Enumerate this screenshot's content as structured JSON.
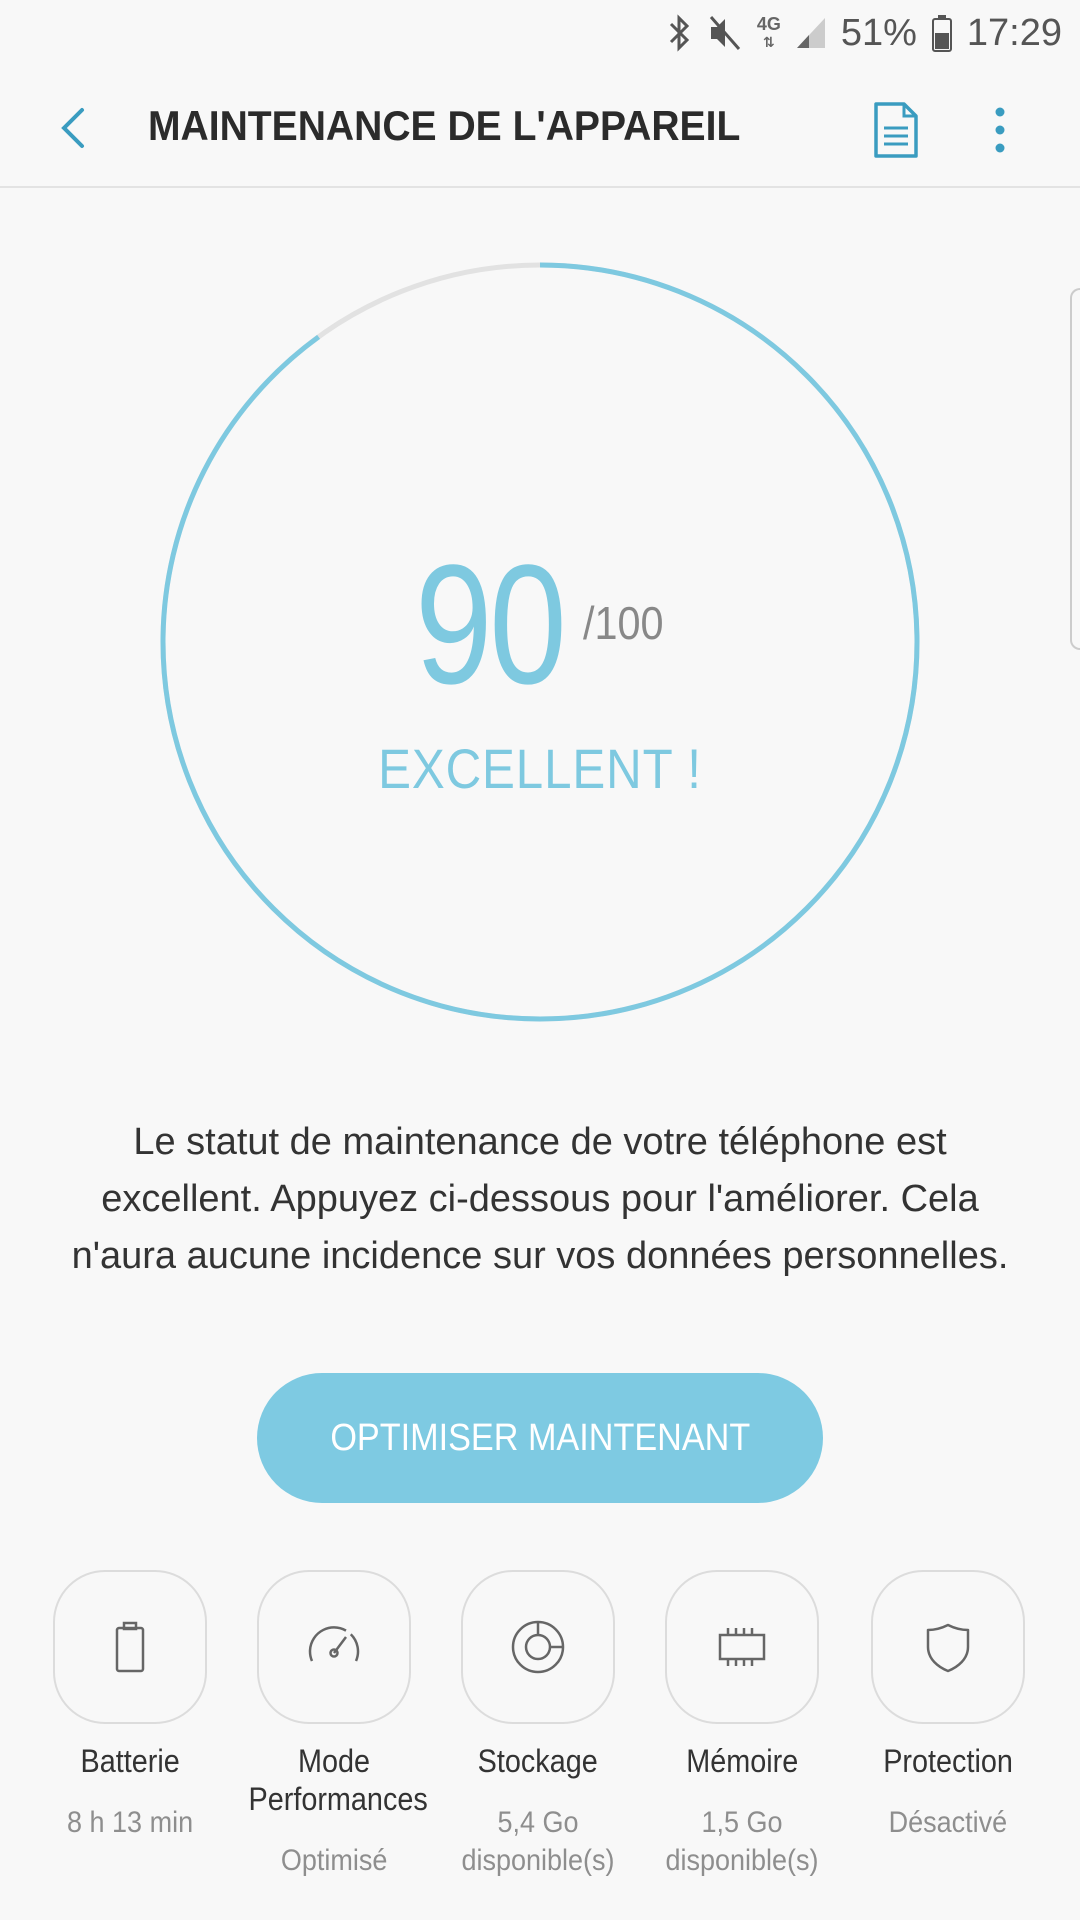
{
  "status_bar": {
    "network_type": "4G",
    "battery_percent": "51%",
    "time": "17:29"
  },
  "app_bar": {
    "title": "MAINTENANCE DE L'APPAREIL"
  },
  "score": {
    "value": "90",
    "max": "/100",
    "fraction": 0.9,
    "status": "EXCELLENT !",
    "accent_color": "#7ec9e0"
  },
  "description": "Le statut de maintenance de votre téléphone est excellent. Appuyez ci-dessous pour l'améliorer. Cela n'aura aucune incidence sur vos données personnelles.",
  "optimize_button": {
    "label": "OPTIMISER MAINTENANT",
    "color": "#7ecae2"
  },
  "categories": [
    {
      "icon": "battery-icon",
      "label": "Batterie",
      "value": "8 h 13 min"
    },
    {
      "icon": "speedometer-icon",
      "label": "Mode Performances",
      "value": "Optimisé"
    },
    {
      "icon": "storage-icon",
      "label": "Stockage",
      "value": "5,4 Go disponible(s)"
    },
    {
      "icon": "memory-chip-icon",
      "label": "Mémoire",
      "value": "1,5 Go disponible(s)"
    },
    {
      "icon": "shield-icon",
      "label": "Protection",
      "value": "Désactivé"
    }
  ]
}
